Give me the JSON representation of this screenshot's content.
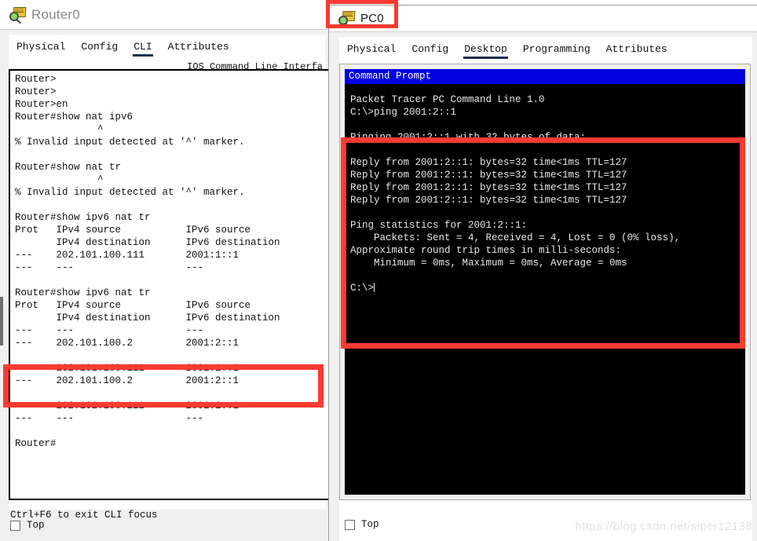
{
  "router_window": {
    "title": "Router0",
    "icon": "packet-tracer-device-icon",
    "tabs": [
      {
        "label": "Physical",
        "active": false
      },
      {
        "label": "Config",
        "active": false
      },
      {
        "label": "CLI",
        "active": true
      },
      {
        "label": "Attributes",
        "active": false
      }
    ],
    "cli_caption": "IOS Command Line Interfa",
    "console_text": "Router>\nRouter>\nRouter>en\nRouter#show nat ipv6\n              ^\n% Invalid input detected at '^' marker.\n\nRouter#show nat tr\n              ^\n% Invalid input detected at '^' marker.\n\nRouter#show ipv6 nat tr\nProt   IPv4 source           IPv6 source\n       IPv4 destination      IPv6 destination\n---    202.101.100.111       2001:1::1\n---    ---                   ---\n\nRouter#show ipv6 nat tr\nProt   IPv4 source           IPv6 source\n       IPv4 destination      IPv6 destination\n---    ---                   ---\n---    202.101.100.2         2001:2::1\n\n---    202.101.100.111       2001:1::1\n---    202.101.100.2         2001:2::1\n\n---    202.101.100.111       2001:1::1\n---    ---                   ---\n\nRouter#",
    "hint": "Ctrl+F6 to exit CLI focus",
    "top_checkbox_label": "Top"
  },
  "pc_window": {
    "title": "PC0",
    "icon": "packet-tracer-device-icon",
    "tabs": [
      {
        "label": "Physical",
        "active": false
      },
      {
        "label": "Config",
        "active": false
      },
      {
        "label": "Desktop",
        "active": true
      },
      {
        "label": "Programming",
        "active": false
      },
      {
        "label": "Attributes",
        "active": false
      }
    ],
    "command_prompt_title": "Command Prompt",
    "terminal_text": "Packet Tracer PC Command Line 1.0\nC:\\>ping 2001:2::1\n\nPinging 2001:2::1 with 32 bytes of data:\n\nReply from 2001:2::1: bytes=32 time<1ms TTL=127\nReply from 2001:2::1: bytes=32 time<1ms TTL=127\nReply from 2001:2::1: bytes=32 time<1ms TTL=127\nReply from 2001:2::1: bytes=32 time<1ms TTL=127\n\nPing statistics for 2001:2::1:\n    Packets: Sent = 4, Received = 4, Lost = 0 (0% loss),\nApproximate round trip times in milli-seconds:\n    Minimum = 0ms, Maximum = 0ms, Average = 0ms\n\nC:\\>",
    "top_checkbox_label": "Top"
  },
  "annotations": {
    "highlight_color": "#f93b32",
    "boxes": [
      {
        "name": "nat-translation-rows-highlight"
      },
      {
        "name": "pc0-title-highlight"
      },
      {
        "name": "ping-output-highlight"
      }
    ]
  },
  "watermark": "https://blog.csdn.net/siper12138"
}
